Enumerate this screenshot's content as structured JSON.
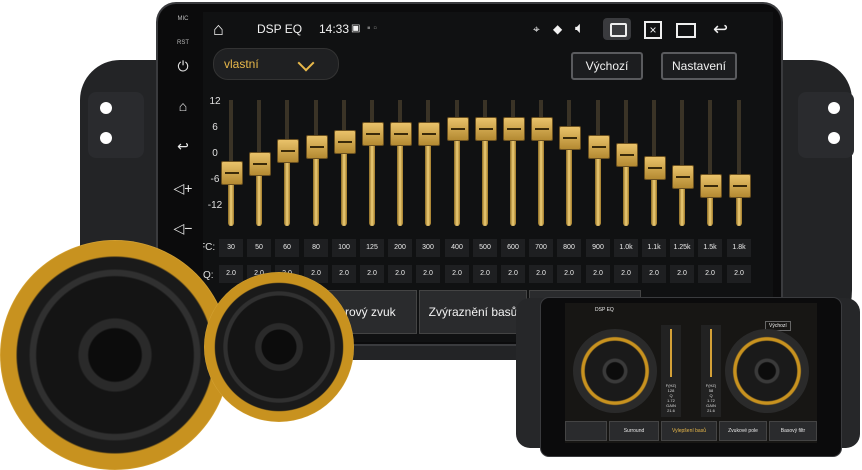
{
  "side_keys": {
    "mic": "MIC",
    "rst": "RST"
  },
  "status_bar": {
    "title": "DSP EQ",
    "time": "14:33"
  },
  "preset_dropdown": {
    "value": "vlastní"
  },
  "buttons": {
    "default": "Výchozí",
    "settings": "Nastavení"
  },
  "eq": {
    "scale": [
      "12",
      "6",
      "0",
      "-6",
      "-12"
    ],
    "fc_label": "FC:",
    "q_label": "Q:",
    "bands": [
      {
        "fc": "30",
        "q": "2.0",
        "gain": -2
      },
      {
        "fc": "50",
        "q": "2.0",
        "gain": 0
      },
      {
        "fc": "60",
        "q": "2.0",
        "gain": 3
      },
      {
        "fc": "80",
        "q": "2.0",
        "gain": 4
      },
      {
        "fc": "100",
        "q": "2.0",
        "gain": 5
      },
      {
        "fc": "125",
        "q": "2.0",
        "gain": 7
      },
      {
        "fc": "200",
        "q": "2.0",
        "gain": 7
      },
      {
        "fc": "300",
        "q": "2.0",
        "gain": 7
      },
      {
        "fc": "400",
        "q": "2.0",
        "gain": 8
      },
      {
        "fc": "500",
        "q": "2.0",
        "gain": 8
      },
      {
        "fc": "600",
        "q": "2.0",
        "gain": 8
      },
      {
        "fc": "700",
        "q": "2.0",
        "gain": 8
      },
      {
        "fc": "800",
        "q": "2.0",
        "gain": 6
      },
      {
        "fc": "900",
        "q": "2.0",
        "gain": 4
      },
      {
        "fc": "1.0k",
        "q": "2.0",
        "gain": 2
      },
      {
        "fc": "1.1k",
        "q": "2.0",
        "gain": -1
      },
      {
        "fc": "1.25k",
        "q": "2.0",
        "gain": -3
      },
      {
        "fc": "1.5k",
        "q": "2.0",
        "gain": -5
      },
      {
        "fc": "1.8k",
        "q": "2.0",
        "gain": -5
      }
    ]
  },
  "tabs": [
    "Prostorový zvuk",
    "Zvýraznění basů"
  ],
  "second_device": {
    "title": "DSP EQ",
    "default_button": "Výchozí",
    "panel_left": [
      "F(HZ)",
      "128",
      "Q",
      "1.72",
      "GAIN",
      "21.6"
    ],
    "panel_right": [
      "F(HZ)",
      "58",
      "Q",
      "1.72",
      "GAIN",
      "21.6"
    ],
    "tabs": [
      "Surround",
      "Vylepšení basů",
      "Zvukové pole",
      "Basový filtr"
    ]
  },
  "colors": {
    "accent": "#e8b84a",
    "gold": "#d4a137",
    "screen": "#101112"
  }
}
